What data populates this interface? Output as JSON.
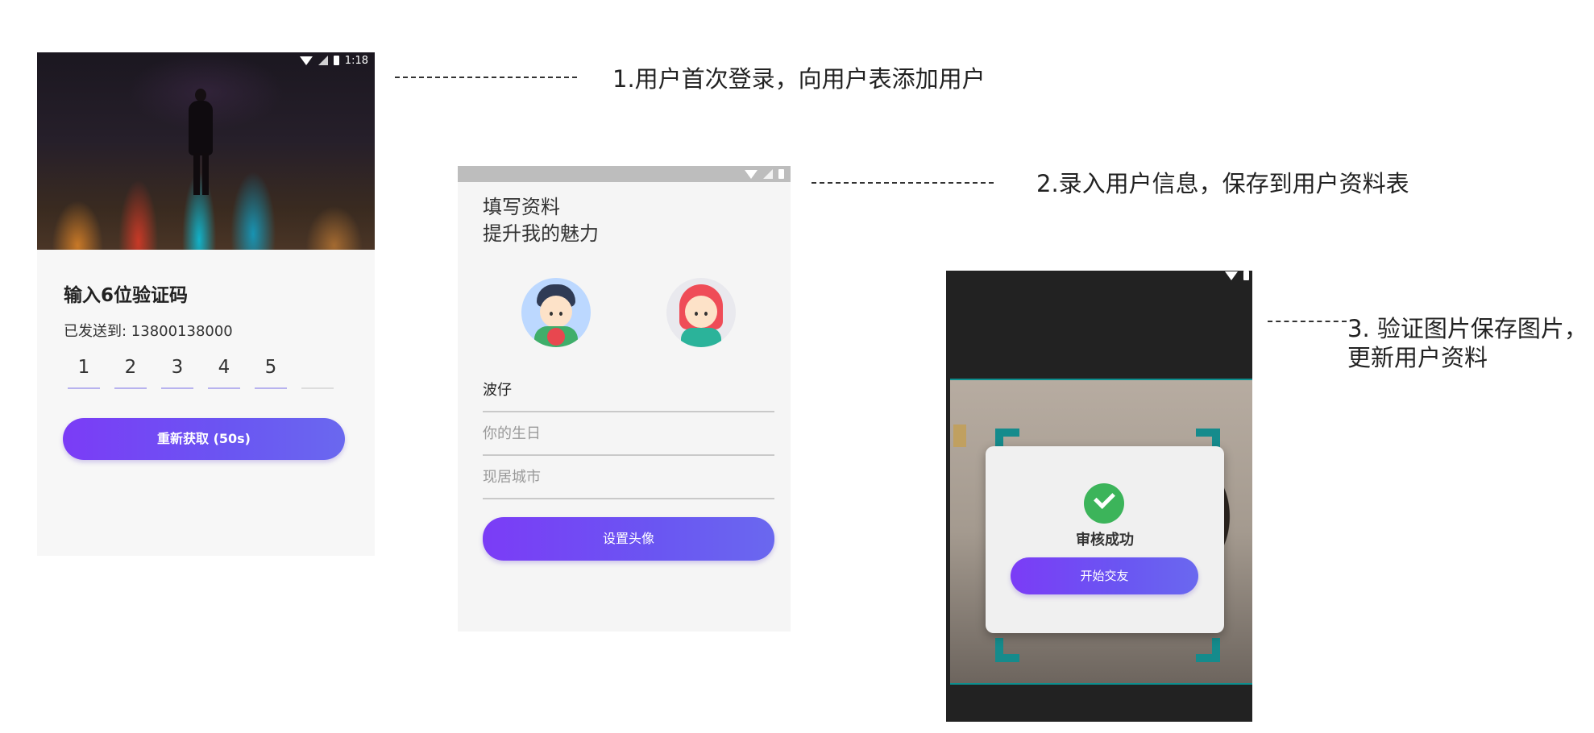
{
  "screen1": {
    "status_time": "1:18",
    "title": "输入6位验证码",
    "sent_label": "已发送到: 13800138000",
    "code_digits": [
      "1",
      "2",
      "3",
      "4",
      "5",
      ""
    ],
    "resend_button": "重新获取 (50s)"
  },
  "screen2": {
    "header_line1": "填写资料",
    "header_line2": "提升我的魅力",
    "nickname_value": "波仔",
    "birthday_placeholder": "你的生日",
    "city_placeholder": "现居城市",
    "avatar_button": "设置头像"
  },
  "screen3": {
    "dialog_status": "审核成功",
    "start_button": "开始交友"
  },
  "annotations": {
    "step1": "1.用户首次登录，向用户表添加用户",
    "step2": "2.录入用户信息，保存到用户资料表",
    "step3_line1": "3. 验证图片保存图片，",
    "step3_line2": "更新用户资料"
  },
  "colors": {
    "button_gradient_start": "#7b3cf6",
    "button_gradient_end": "#6a68ef",
    "success_green": "#3cb45a",
    "scan_frame_teal": "#158b8c"
  }
}
